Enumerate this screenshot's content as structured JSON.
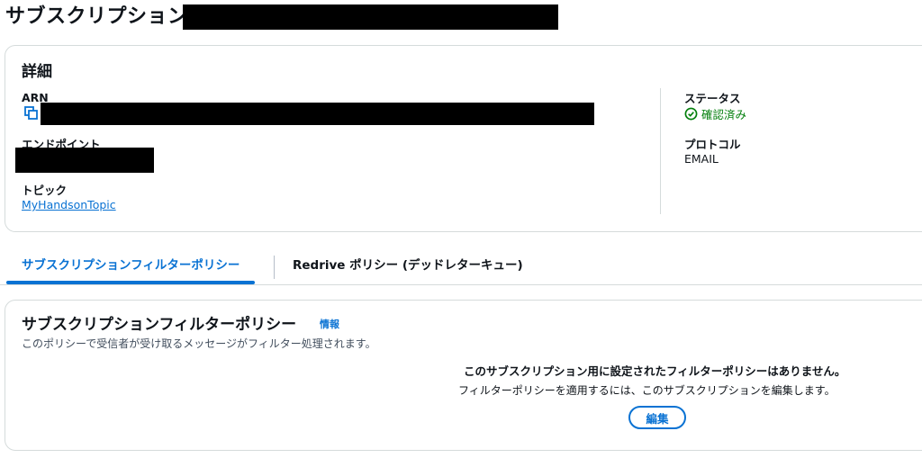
{
  "page": {
    "title": "サブスクリプション: "
  },
  "details": {
    "heading": "詳細",
    "arn_label": "ARN",
    "endpoint_label": "エンドポイント",
    "topic_label": "トピック",
    "topic_value": "MyHandsonTopic",
    "status_label": "ステータス",
    "status_value": "確認済み",
    "protocol_label": "プロトコル",
    "protocol_value": "EMAIL"
  },
  "tabs": [
    {
      "label": "サブスクリプションフィルターポリシー",
      "active": true
    },
    {
      "label": "Redrive ポリシー (デッドレターキュー)",
      "active": false
    }
  ],
  "filter_policy": {
    "heading": "サブスクリプションフィルターポリシー",
    "info_label": "情報",
    "description": "このポリシーで受信者が受け取るメッセージがフィルター処理されます。",
    "empty_title": "このサブスクリプション用に設定されたフィルターポリシーはありません。",
    "empty_description": "フィルターポリシーを適用するには、このサブスクリプションを編集します。",
    "edit_button": "編集"
  },
  "colors": {
    "accent": "#0972d3",
    "success": "#037f0c",
    "border": "#d5dbdb"
  },
  "icons": [
    "copy-icon",
    "check-circle-icon"
  ]
}
